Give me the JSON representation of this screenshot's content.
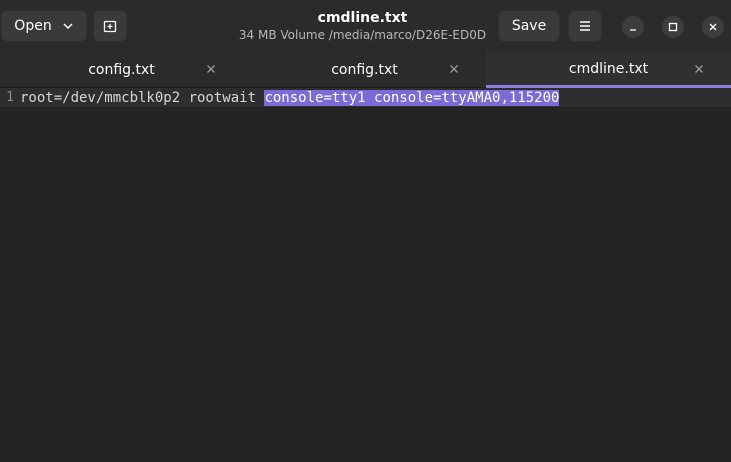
{
  "header": {
    "open_label": "Open",
    "save_label": "Save",
    "title": "cmdline.txt",
    "subtitle": "34 MB Volume /media/marco/D26E-ED0D"
  },
  "tabs": [
    {
      "label": "config.txt",
      "active": false
    },
    {
      "label": "config.txt",
      "active": false
    },
    {
      "label": "cmdline.txt",
      "active": true
    }
  ],
  "editor": {
    "line_number": "1",
    "text_plain": "root=/dev/mmcblk0p2 rootwait ",
    "text_selected": "console=tty1 console=ttyAMA0,115200"
  },
  "colors": {
    "accent": "#8a7fde",
    "selection": "#7c6ad6",
    "background": "#242424",
    "headerbar": "#2b2b2b"
  },
  "icons": [
    "chevron-down-icon",
    "new-tab-icon",
    "hamburger-menu-icon",
    "minimize-icon",
    "maximize-icon",
    "close-icon"
  ]
}
